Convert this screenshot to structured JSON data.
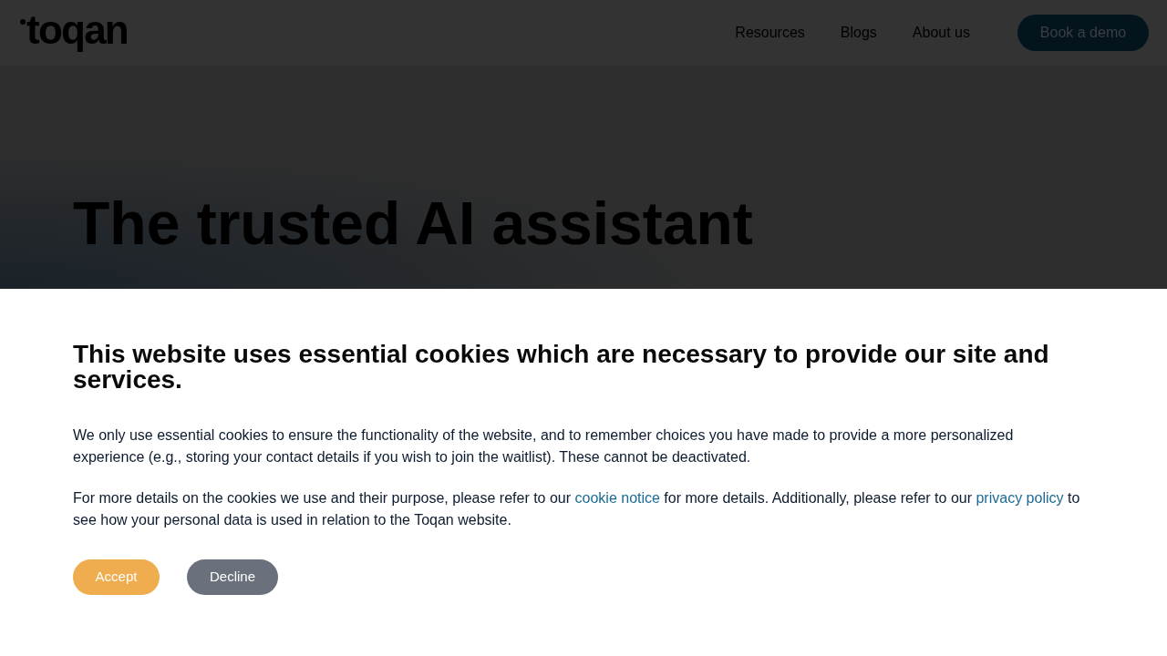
{
  "header": {
    "logo": {
      "text": "toqan"
    },
    "nav": [
      "Resources",
      "Blogs",
      "About us"
    ],
    "cta": {
      "label": "Book a demo"
    }
  },
  "hero": {
    "title": "The trusted AI assistant"
  },
  "cookie_banner": {
    "title": "This website uses essential cookies which are necessary to provide our site and services.",
    "paragraphs": [
      {
        "segments": [
          {
            "kind": "text",
            "text": "We only use essential cookies to ensure the functionality of the website, and to remember choices you have made to provide a more personalized experience (e.g., storing your contact details if you wish to join the waitlist). These cannot be deactivated."
          }
        ]
      },
      {
        "segments": [
          {
            "kind": "text",
            "text": "For more details on the cookies we use and their purpose, please refer to our "
          },
          {
            "kind": "link",
            "text": "cookie notice"
          },
          {
            "kind": "text",
            "text": " for more details. Additionally, please refer to our "
          },
          {
            "kind": "link",
            "text": "privacy policy"
          },
          {
            "kind": "text",
            "text": " to see how your personal data is used in relation to the Toqan website."
          }
        ]
      }
    ],
    "buttons": [
      {
        "label": "Accept",
        "kind": "primary"
      },
      {
        "label": "Decline",
        "kind": "secondary"
      }
    ]
  }
}
